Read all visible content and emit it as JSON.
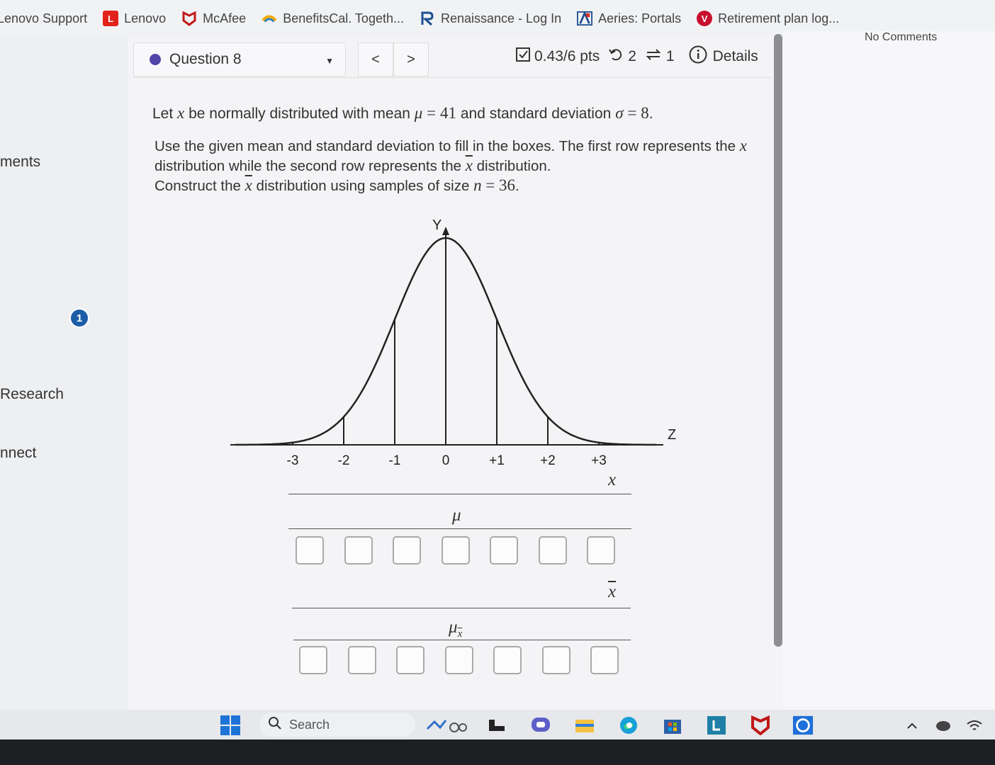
{
  "bookmarks": [
    {
      "label": "Lenovo Support",
      "icon": "lenovo-support-icon",
      "color": "#e2231a"
    },
    {
      "label": "Lenovo",
      "icon": "lenovo-icon",
      "color": "#e2231a"
    },
    {
      "label": "McAfee",
      "icon": "mcafee-icon",
      "color": "#c01818"
    },
    {
      "label": "BenefitsCal. Togeth...",
      "icon": "benefitscal-icon",
      "color": "#f2a900"
    },
    {
      "label": "Renaissance - Log In",
      "icon": "renaissance-icon",
      "color": "#1d4f91"
    },
    {
      "label": "Aeries: Portals",
      "icon": "aeries-icon",
      "color": "#1d4f91"
    },
    {
      "label": "Retirement plan log...",
      "icon": "retirement-icon",
      "color": "#c8102e"
    }
  ],
  "sidebar": {
    "items": [
      {
        "label": "ments"
      },
      {
        "label": "Research"
      },
      {
        "label": "nnect"
      }
    ],
    "badge": "1"
  },
  "question_nav": {
    "label": "Question 8",
    "prev": "<",
    "next": ">"
  },
  "score": {
    "points": "0.43/6 pts",
    "retries": "2",
    "submissions": "1",
    "details": "Details"
  },
  "question": {
    "line1_pre": "Let",
    "var_x": "x",
    "line1_mid": "be normally distributed with mean",
    "mu_sym": "μ",
    "eq": "=",
    "mean": "41",
    "line1_mid2": "and standard deviation",
    "sigma_sym": "σ",
    "sd": "8",
    "period": ".",
    "line2_a": "Use the given mean and standard deviation to fill in the boxes. The first row represents the",
    "line2_b": "distribution while the second row represents the",
    "line2_c": "distribution.",
    "line3_a": "Construct the",
    "line3_b": "distribution using samples of size",
    "n_sym": "n",
    "n_val": "36"
  },
  "graph": {
    "y_label": "Y",
    "z_label": "Z",
    "ticks": [
      "-3",
      "-2",
      "-1",
      "0",
      "+1",
      "+2",
      "+3"
    ],
    "row1_var": "x",
    "row1_mean": "μ",
    "row2_var": "x",
    "row2_mean": "μx",
    "row1_values": [
      "",
      "",
      "",
      "",
      "",
      "",
      ""
    ],
    "row2_values": [
      "",
      "",
      "",
      "",
      "",
      "",
      ""
    ]
  },
  "comments": {
    "label": "No Comments"
  },
  "taskbar": {
    "search_placeholder": "Search"
  }
}
